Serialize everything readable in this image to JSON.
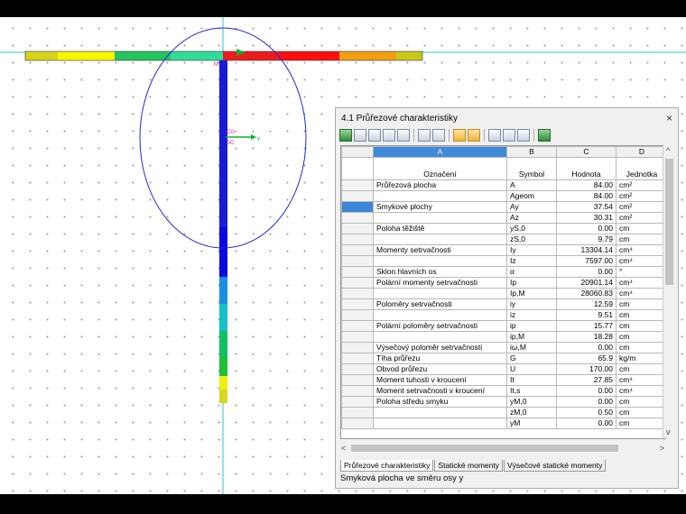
{
  "model": {
    "labels": {
      "m": "M",
      "cg": "CG",
      "sc": "SC",
      "y": "y"
    },
    "colors": {
      "yellow": "#d6d41a",
      "green": "#23c45e",
      "red": "#ec1c1c",
      "orange": "#f0a015",
      "blue": "#1515d2",
      "cyan": "#2fc8d8",
      "ellipse": "#2626d6"
    }
  },
  "panel": {
    "title": "4.1 Průřezové charakteristiky",
    "close_label": "×",
    "columns": [
      "A",
      "B",
      "C",
      "D"
    ],
    "headers": {
      "name": "Označení",
      "symbol": "Symbol",
      "value": "Hodnota",
      "unit": "Jednotka"
    },
    "rows": [
      {
        "name": "Průřezová plocha",
        "symbol": "A",
        "value": "84.00",
        "unit": "cm²"
      },
      {
        "name": "",
        "symbol": "Ageom",
        "value": "84.00",
        "unit": "cm²"
      },
      {
        "name": "Smykové plochy",
        "symbol": "Ay",
        "value": "37.54",
        "unit": "cm²"
      },
      {
        "name": "",
        "symbol": "Az",
        "value": "30.31",
        "unit": "cm²"
      },
      {
        "name": "Poloha těžiště",
        "symbol": "yS,0",
        "value": "0.00",
        "unit": "cm"
      },
      {
        "name": "",
        "symbol": "zS,0",
        "value": "9.79",
        "unit": "cm"
      },
      {
        "name": "Momenty setrvačnosti",
        "symbol": "Iy",
        "value": "13304.14",
        "unit": "cm⁴"
      },
      {
        "name": "",
        "symbol": "Iz",
        "value": "7597.00",
        "unit": "cm⁴"
      },
      {
        "name": "Sklon hlavních os",
        "symbol": "α",
        "value": "0.00",
        "unit": "°"
      },
      {
        "name": "Polární momenty setrvačnosti",
        "symbol": "Ip",
        "value": "20901.14",
        "unit": "cm⁴"
      },
      {
        "name": "",
        "symbol": "Ip,M",
        "value": "28060.83",
        "unit": "cm⁴"
      },
      {
        "name": "Poloměry setrvačnosti",
        "symbol": "iy",
        "value": "12.59",
        "unit": "cm"
      },
      {
        "name": "",
        "symbol": "iz",
        "value": "9.51",
        "unit": "cm"
      },
      {
        "name": "Polární poloměry setrvačnosti",
        "symbol": "ip",
        "value": "15.77",
        "unit": "cm"
      },
      {
        "name": "",
        "symbol": "ip,M",
        "value": "18.28",
        "unit": "cm"
      },
      {
        "name": "Výsečový poloměr setrvačnosti",
        "symbol": "iω,M",
        "value": "0.00",
        "unit": "cm"
      },
      {
        "name": "Tíha průřezu",
        "symbol": "G",
        "value": "65.9",
        "unit": "kg/m"
      },
      {
        "name": "Obvod průřezu",
        "symbol": "U",
        "value": "170.00",
        "unit": "cm"
      },
      {
        "name": "Moment tuhosti v kroucení",
        "symbol": "It",
        "value": "27.85",
        "unit": "cm⁴"
      },
      {
        "name": "Moment setrvačnosti v kroucení",
        "symbol": "It,s",
        "value": "0.00",
        "unit": "cm⁴"
      },
      {
        "name": "Poloha středu smyku",
        "symbol": "yM,0",
        "value": "0.00",
        "unit": "cm"
      },
      {
        "name": "",
        "symbol": "zM,0",
        "value": "0.50",
        "unit": "cm"
      },
      {
        "name": "",
        "symbol": "yM",
        "value": "0.00",
        "unit": "cm"
      }
    ],
    "tabs": [
      "Průřezové charakteristiky",
      "Statické momenty",
      "Výsečové statické momenty"
    ],
    "status": "Smyková plocha ve směru osy y",
    "scroll": {
      "left": "<",
      "right": ">",
      "up": "^",
      "down": "v"
    }
  }
}
